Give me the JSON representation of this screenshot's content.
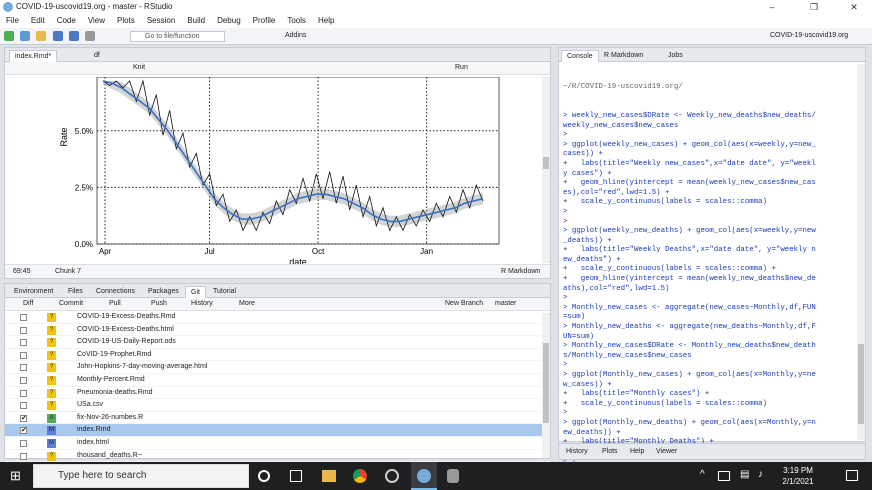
{
  "window": {
    "title": "COVID-19-uscovid19.org - master - RStudio"
  },
  "menu": [
    "File",
    "Edit",
    "Code",
    "View",
    "Plots",
    "Session",
    "Build",
    "Debug",
    "Profile",
    "Tools",
    "Help"
  ],
  "toolbar": {
    "goto_placeholder": "Go to file/function",
    "addins": "Addins",
    "project": "COVID-19-uscovid19.org"
  },
  "source": {
    "tabs": [
      "index.Rmd*",
      "df"
    ],
    "knit": "Knit",
    "run": "Run",
    "chart_data": {
      "type": "line",
      "title": "",
      "xlabel": "date",
      "ylabel": "Rate",
      "x_ticks": [
        "Apr",
        "Jul",
        "Oct",
        "Jan"
      ],
      "y_ticks": [
        "0.0%",
        "2.5%",
        "5.0%"
      ],
      "series": [
        {
          "values": [
            7.8,
            7.0,
            8.2,
            6.9,
            7.6,
            6.3,
            7.4,
            5.7,
            6.6,
            4.8,
            5.9,
            4.2,
            4.9,
            3.4,
            4.0,
            2.6,
            3.1,
            1.7,
            2.2,
            1.0,
            1.5,
            0.6,
            1.2,
            0.6,
            1.4,
            0.9,
            1.9,
            1.3,
            2.4,
            1.8,
            2.9,
            1.9,
            3.1,
            2.0,
            3.2,
            1.8,
            3.0,
            1.5,
            2.6,
            1.2,
            2.1,
            0.8,
            1.6,
            0.6,
            1.2,
            0.6,
            1.3,
            0.8,
            1.5,
            1.0,
            1.8,
            1.2,
            2.1,
            1.4,
            2.4,
            1.6,
            2.6,
            1.9
          ]
        },
        {
          "values": [
            7.3,
            7.1,
            6.9,
            6.6,
            6.3,
            6.0,
            5.5,
            5.0,
            4.4,
            3.8,
            3.2,
            2.6,
            2.0,
            1.6,
            1.3,
            1.1,
            1.1,
            1.2,
            1.4,
            1.6,
            1.8,
            2.0,
            2.1,
            2.2,
            2.2,
            2.1,
            2.0,
            1.8,
            1.6,
            1.3,
            1.1,
            1.0,
            1.0,
            1.1,
            1.2,
            1.3,
            1.4,
            1.5,
            1.6,
            1.8,
            1.9,
            2.0
          ]
        }
      ]
    },
    "status_pos": "69:45",
    "status_chunk": "Chunk 7",
    "status_mode": "R Markdown"
  },
  "console": {
    "tabs": [
      "Console",
      "R Markdown",
      "Jobs"
    ],
    "path": "~/R/COVID-19-uscovid19.org/",
    "lines": [
      "> weekly_new_cases$DRate <- Weekly_new_deaths$new_deaths/",
      "weekly_new_cases$new_cases",
      ">",
      "> ggplot(weekly_new_cases) + geom_col(aes(x=weekly,y=new_",
      "cases)) +",
      "+   labs(title=\"Weekly new_cases\",x=\"date date\", y=\"weekl",
      "y cases\") +",
      "+   geom_hline(yintercept = mean(weekly_new_cases$new_cas",
      "es),col=\"red\",lwd=1.5) +",
      "+   scale_y_continuous(labels = scales::comma)",
      ">",
      ">",
      "> ggplot(weekly_new_deaths) + geom_col(aes(x=weekly,y=new",
      "_deaths)) +",
      "+   labs(title=\"Weekly Deaths\",x=\"date date\", y=\"weekly n",
      "ew_deaths\") +",
      "+   scale_y_continuous(labels = scales::comma) +",
      "+   geom_hline(yintercept = mean(weekly_new_deaths$new_de",
      "aths),col=\"red\",lwd=1.5)",
      ">",
      "> Monthly_new_cases <- aggregate(new_cases~Monthly,df,FUN",
      "=sum)",
      "> Monthly_new_deaths <- aggregate(new_deaths~Monthly,df,F",
      "UN=sum)",
      "> Monthly_new_cases$DRate <- Monthly_new_deaths$new_death",
      "s/Monthly_new_cases$new_cases",
      ">",
      "> ggplot(Monthly_new_cases) + geom_col(aes(x=Monthly,y=ne",
      "w_cases)) +",
      "+   labs(title=\"Monthly cases\") +",
      "+   scale_y_continuous(labels = scales::comma)",
      ">",
      "> ggplot(Monthly_new_deaths) + geom_col(aes(x=Monthly,y=n",
      "ew_deaths)) +",
      "+   labs(title=\"Monthly Deaths\") +",
      "+   scale_y_continuous(labels = scales::comma)",
      "> |"
    ]
  },
  "bottom_right": {
    "tabs": [
      "History",
      "Plots",
      "Help",
      "Viewer"
    ]
  },
  "git_pane": {
    "tabs": [
      "Environment",
      "Files",
      "Connections",
      "Packages",
      "Git",
      "Tutorial"
    ],
    "actions": [
      "Diff",
      "Commit",
      "Pull",
      "Push",
      "History",
      "More",
      "New Branch",
      "master"
    ],
    "files": [
      {
        "name": "COVID-19-Excess-Deaths.Rmd",
        "checked": false,
        "status": "?"
      },
      {
        "name": "COVID-19-Excess-Deaths.html",
        "checked": false,
        "status": "?"
      },
      {
        "name": "COVID-19-US-Daily-Report.ods",
        "checked": false,
        "status": "?"
      },
      {
        "name": "CoVID-19-Prophet.Rmd",
        "checked": false,
        "status": "?"
      },
      {
        "name": "John-Hopkins-7-day-moving-average.html",
        "checked": false,
        "status": "?"
      },
      {
        "name": "Monthly-Percent.Rmd",
        "checked": false,
        "status": "?"
      },
      {
        "name": "Pneumonia-deaths.Rmd",
        "checked": false,
        "status": "?"
      },
      {
        "name": "USa.csv",
        "checked": false,
        "status": "?"
      },
      {
        "name": "fix-Nov-26-numbes.R",
        "checked": true,
        "status": "A"
      },
      {
        "name": "index.Rmd",
        "checked": true,
        "status": "M"
      },
      {
        "name": "index.html",
        "checked": false,
        "status": "M"
      },
      {
        "name": "thousand_deaths.R~",
        "checked": false,
        "status": "?"
      }
    ]
  },
  "taskbar": {
    "search_placeholder": "Type here to search",
    "time": "3:19 PM",
    "date": "2/1/2021"
  },
  "colors": {
    "accent_blue": "#3a6fc4",
    "selected_row": "#a9c8ee",
    "git_yellow": "#f1c40f",
    "git_green": "#4caf50",
    "git_blue": "#5b7fd6"
  }
}
